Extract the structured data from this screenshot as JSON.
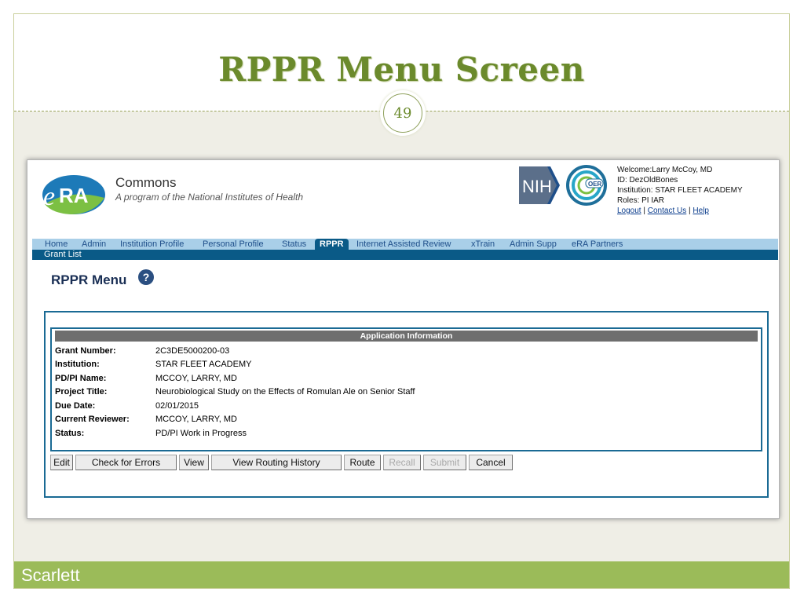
{
  "slide": {
    "title": "RPPR Menu Screen",
    "page_number": "49",
    "footer_text": "Scarlett",
    "accent_color": "#9bbb59",
    "title_color": "#6b8a2c"
  },
  "header": {
    "logo_text": "eRA",
    "app_name": "Commons",
    "tagline": "A program of the National Institutes of Health",
    "nih_logo_text": "NIH",
    "oer_logo_text": "OER"
  },
  "user": {
    "welcome": "Welcome:Larry McCoy, MD",
    "id": "ID: DezOldBones",
    "institution": "Institution: STAR FLEET ACADEMY",
    "roles": "Roles:  PI  IAR",
    "logout": "Logout",
    "separator": "|",
    "contact": "Contact Us",
    "help": "Help"
  },
  "nav": {
    "items": [
      {
        "label": "Home"
      },
      {
        "label": "Admin"
      },
      {
        "label": "Institution Profile"
      },
      {
        "label": "Personal Profile"
      },
      {
        "label": "Status"
      },
      {
        "label": "RPPR",
        "active": true
      },
      {
        "label": "Internet Assisted Review"
      },
      {
        "label": "xTrain"
      },
      {
        "label": "Admin Supp"
      },
      {
        "label": "eRA Partners"
      }
    ],
    "sub_item": "Grant List",
    "bar_color": "#a9cfe8",
    "active_color": "#0a5a87"
  },
  "page": {
    "title": "RPPR Menu",
    "help_icon": "?"
  },
  "application_info": {
    "header": "Application Information",
    "rows": [
      {
        "label": "Grant Number:",
        "value": "2C3DE5000200-03"
      },
      {
        "label": "Institution:",
        "value": "STAR FLEET ACADEMY"
      },
      {
        "label": "PD/PI Name:",
        "value": "MCCOY, LARRY, MD"
      },
      {
        "label": "Project Title:",
        "value": "Neurobiological Study on the Effects of Romulan Ale on Senior Staff"
      },
      {
        "label": "Due Date:",
        "value": "02/01/2015"
      },
      {
        "label": "Current Reviewer:",
        "value": "MCCOY, LARRY, MD"
      },
      {
        "label": "Status:",
        "value": "PD/PI Work in Progress"
      }
    ]
  },
  "buttons": {
    "edit": "Edit",
    "check_errors": "Check for Errors",
    "view": "View",
    "view_routing": "View Routing History",
    "route": "Route",
    "recall": "Recall",
    "submit": "Submit",
    "cancel": "Cancel"
  }
}
